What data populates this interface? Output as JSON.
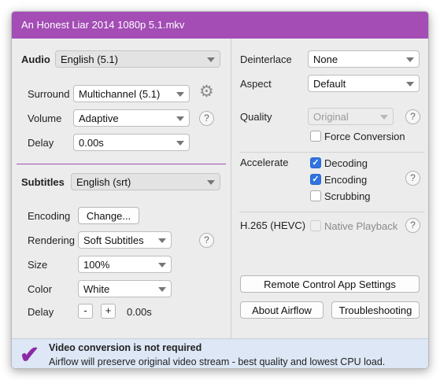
{
  "window": {
    "title": "An Honest Liar 2014 1080p 5.1.mkv"
  },
  "audio": {
    "heading": "Audio",
    "track": "English (5.1)",
    "surround_label": "Surround",
    "surround_value": "Multichannel (5.1)",
    "volume_label": "Volume",
    "volume_value": "Adaptive",
    "delay_label": "Delay",
    "delay_value": "0.00s"
  },
  "subtitles": {
    "heading": "Subtitles",
    "track": "English (srt)",
    "encoding_label": "Encoding",
    "encoding_button": "Change...",
    "rendering_label": "Rendering",
    "rendering_value": "Soft Subtitles",
    "size_label": "Size",
    "size_value": "100%",
    "color_label": "Color",
    "color_value": "White",
    "delay_label": "Delay",
    "delay_minus": "-",
    "delay_plus": "+",
    "delay_value": "0.00s"
  },
  "video": {
    "deinterlace_label": "Deinterlace",
    "deinterlace_value": "None",
    "aspect_label": "Aspect",
    "aspect_value": "Default",
    "quality_label": "Quality",
    "quality_value": "Original",
    "force_conversion_label": "Force Conversion",
    "force_conversion_checked": false,
    "accelerate_label": "Accelerate",
    "decoding_label": "Decoding",
    "decoding_checked": true,
    "encoding_label": "Encoding",
    "encoding_checked": true,
    "scrubbing_label": "Scrubbing",
    "scrubbing_checked": false,
    "hevc_label": "H.265 (HEVC)",
    "native_playback_label": "Native Playback",
    "native_playback_checked": false
  },
  "buttons": {
    "remote_control": "Remote Control App Settings",
    "about": "About Airflow",
    "troubleshooting": "Troubleshooting"
  },
  "footer": {
    "title": "Video conversion is not required",
    "message": "Airflow will preserve original video stream - best quality and lowest CPU load."
  },
  "icons": {
    "help": "?",
    "gear": "⚙",
    "check": "✓",
    "status_check": "✔"
  },
  "colors": {
    "accent_purple": "#a34db5",
    "checkbox_blue": "#2f74e0",
    "footer_background": "#dde7f5"
  }
}
